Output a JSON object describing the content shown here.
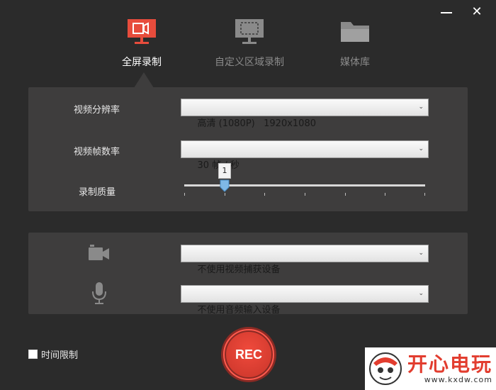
{
  "window": {
    "minimize_icon": "minimize-icon",
    "close_glyph": "✕"
  },
  "tabs": [
    {
      "label": "全屏录制",
      "icon": "monitor-record-icon",
      "active": true,
      "color": "#e74c3c"
    },
    {
      "label": "自定义区域录制",
      "icon": "monitor-region-icon",
      "active": false
    },
    {
      "label": "媒体库",
      "icon": "folder-icon",
      "active": false
    }
  ],
  "settings": {
    "resolution_label": "视频分辨率",
    "resolution_value": "高清 (1080P)   1920x1080",
    "framerate_label": "视频帧数率",
    "framerate_value": "30 帧 / 秒",
    "quality_label": "录制质量",
    "quality_value": "1",
    "quality_level": 0.17
  },
  "devices": {
    "camera_icon": "camera-icon",
    "camera_value": "不使用视频捕获设备",
    "mic_icon": "microphone-icon",
    "mic_value": "不使用音频输入设备"
  },
  "footer": {
    "time_limit_label": "时间限制",
    "time_limit_checked": false,
    "rec_label": "REC",
    "rec_color": "#e04133"
  },
  "watermark": {
    "brand": "开心电玩",
    "url": "www.kxdw.com"
  }
}
